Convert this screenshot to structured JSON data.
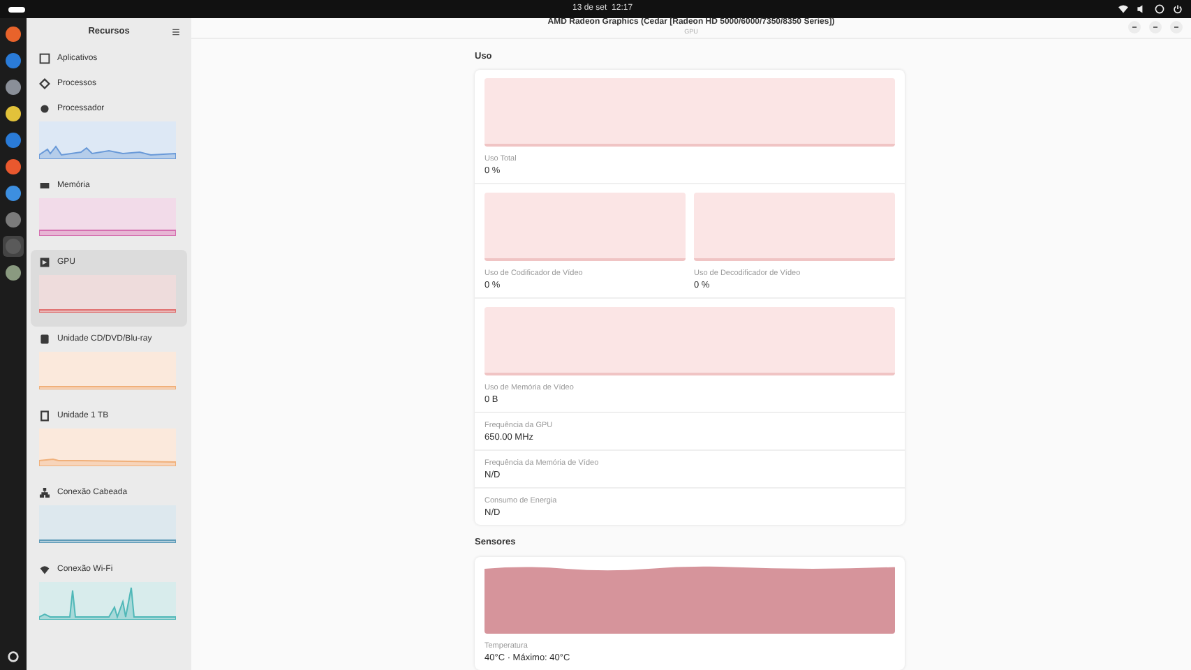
{
  "top_bar": {
    "clock": "13 de set  12:17"
  },
  "dock": [
    {
      "kind": "firefox"
    },
    {
      "kind": "thunderbird"
    },
    {
      "kind": "files"
    },
    {
      "kind": "rhythmbox"
    },
    {
      "kind": "writer"
    },
    {
      "kind": "software"
    },
    {
      "kind": "help"
    },
    {
      "kind": "settings"
    },
    {
      "kind": "monitor",
      "selected": true
    },
    {
      "kind": "trash"
    }
  ],
  "sidebar": {
    "title": "Recursos",
    "items": [
      {
        "label": "Aplicativos",
        "kind": "plain",
        "selected": false
      },
      {
        "label": "Processos",
        "kind": "plain",
        "selected": false
      },
      {
        "label": "Processador",
        "kind": "graph",
        "color": "#6a9ad8",
        "selected": false
      },
      {
        "label": "Memória",
        "kind": "graph",
        "color": "#d56fb0",
        "selected": false
      },
      {
        "label": "GPU",
        "kind": "graph",
        "color": "#e07070",
        "selected": true
      },
      {
        "label": "Unidade CD/DVD/Blu-ray",
        "kind": "graph",
        "color": "#f0b07a",
        "selected": false
      },
      {
        "label": "Unidade 1 TB",
        "kind": "graph",
        "color": "#f0b07a",
        "selected": false
      },
      {
        "label": "Conexão Cabeada",
        "kind": "graph",
        "color": "#5e9bb8",
        "selected": false
      },
      {
        "label": "Conexão Wi-Fi",
        "kind": "graph",
        "color": "#50b8b8",
        "selected": false
      }
    ]
  },
  "header": {
    "title": "AMD Radeon Graphics (Cedar [Radeon HD 5000/6000/7350/8350 Series])",
    "subtitle": "GPU"
  },
  "sections": [
    {
      "title": "Uso",
      "rows": [
        {
          "kind": "graph",
          "cells": [
            {
              "label": "Uso Total",
              "value": "0 %"
            }
          ]
        },
        {
          "kind": "graph",
          "cells": [
            {
              "label": "Uso de Codificador de Vídeo",
              "value": "0 %"
            },
            {
              "label": "Uso de Decodificador de Vídeo",
              "value": "0 %"
            }
          ]
        },
        {
          "kind": "graph",
          "cells": [
            {
              "label": "Uso de Memória de Vídeo",
              "value": "0 B"
            }
          ]
        },
        {
          "kind": "text",
          "cells": [
            {
              "label": "Frequência da GPU",
              "value": "650.00 MHz"
            }
          ]
        },
        {
          "kind": "text",
          "cells": [
            {
              "label": "Frequência da Memória de Vídeo",
              "value": "N/D"
            }
          ]
        },
        {
          "kind": "text",
          "cells": [
            {
              "label": "Consumo de Energia",
              "value": "N/D"
            }
          ]
        }
      ]
    },
    {
      "title": "Sensores",
      "rows": [
        {
          "kind": "filled",
          "cells": [
            {
              "label": "Temperatura",
              "value": "40°C · Máximo: 40°C"
            }
          ]
        }
      ]
    }
  ]
}
